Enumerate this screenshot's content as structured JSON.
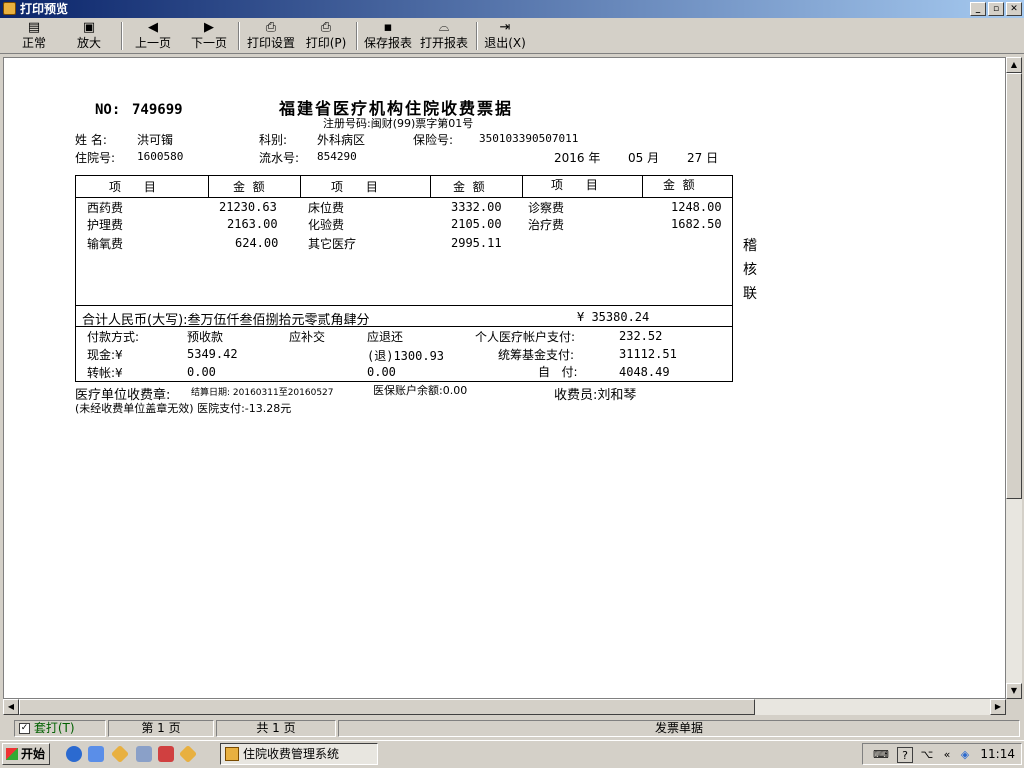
{
  "window": {
    "title": "打印预览"
  },
  "toolbar": {
    "normal": "正常",
    "zoom": "放大",
    "prev": "上一页",
    "next": "下一页",
    "print_setup": "打印设置",
    "print": "打印(P)",
    "save_report": "保存报表",
    "open_report": "打开报表",
    "exit": "退出(X)"
  },
  "receipt": {
    "no_label": "NO:",
    "no": "749699",
    "title": "福建省医疗机构住院收费票据",
    "reg": "注册号码:闽财(99)票字第01号",
    "name_label": "姓   名:",
    "name": "洪可镯",
    "dept_label": "科别:",
    "dept": "外科病区",
    "insurance_label": "保险号:",
    "insurance": "350103390507011",
    "inpatient_label": "住院号:",
    "inpatient": "1600580",
    "serial_label": "流水号:",
    "serial": "854290",
    "year": "2016 年",
    "month": "05 月",
    "day": "27 日",
    "col_item": "项      目",
    "col_amount": "金  额",
    "items": [
      {
        "name": "西药费",
        "amount": "21230.63"
      },
      {
        "name": "护理费",
        "amount": "2163.00"
      },
      {
        "name": "输氧费",
        "amount": "624.00"
      },
      {
        "name": "床位费",
        "amount": "3332.00"
      },
      {
        "name": "化验费",
        "amount": "2105.00"
      },
      {
        "name": "其它医疗",
        "amount": "2995.11"
      },
      {
        "name": "诊察费",
        "amount": "1248.00"
      },
      {
        "name": "治疗费",
        "amount": "1682.50"
      }
    ],
    "side": [
      "稽",
      "核",
      "联"
    ],
    "total_label": "合计人民币(大写):叁万伍仟叁佰捌拾元零贰角肆分",
    "total": "¥ 35380.24",
    "pay_method": "付款方式:",
    "prepaid_label": "预收款",
    "supp_label": "应补交",
    "refund_label": "应退还",
    "personal_label": "个人医疗帐户支付:",
    "personal": "232.52",
    "cash_label": "现金:¥",
    "cash": "5349.42",
    "refund": "(退)1300.93",
    "fund_label": "统筹基金支付:",
    "fund": "31112.51",
    "transfer_label": "转帐:¥",
    "transfer": "0.00",
    "transfer2": "0.00",
    "self_label": "自   付:",
    "self": "4048.49",
    "seal_label": "医疗单位收费章:",
    "period": "结算日期: 20160311至20160527",
    "balance": "医保账户余额:0.00",
    "cashier": "收费员:刘和琴",
    "note": "(未经收费单位盖章无效) 医院支付:-13.28元"
  },
  "status": {
    "check": "套打(T)",
    "page": "第 1 页",
    "pages": "共 1 页",
    "doc": "发票单据"
  },
  "taskbar": {
    "start": "开始",
    "task": "住院收费管理系统",
    "clock": "11:14"
  }
}
